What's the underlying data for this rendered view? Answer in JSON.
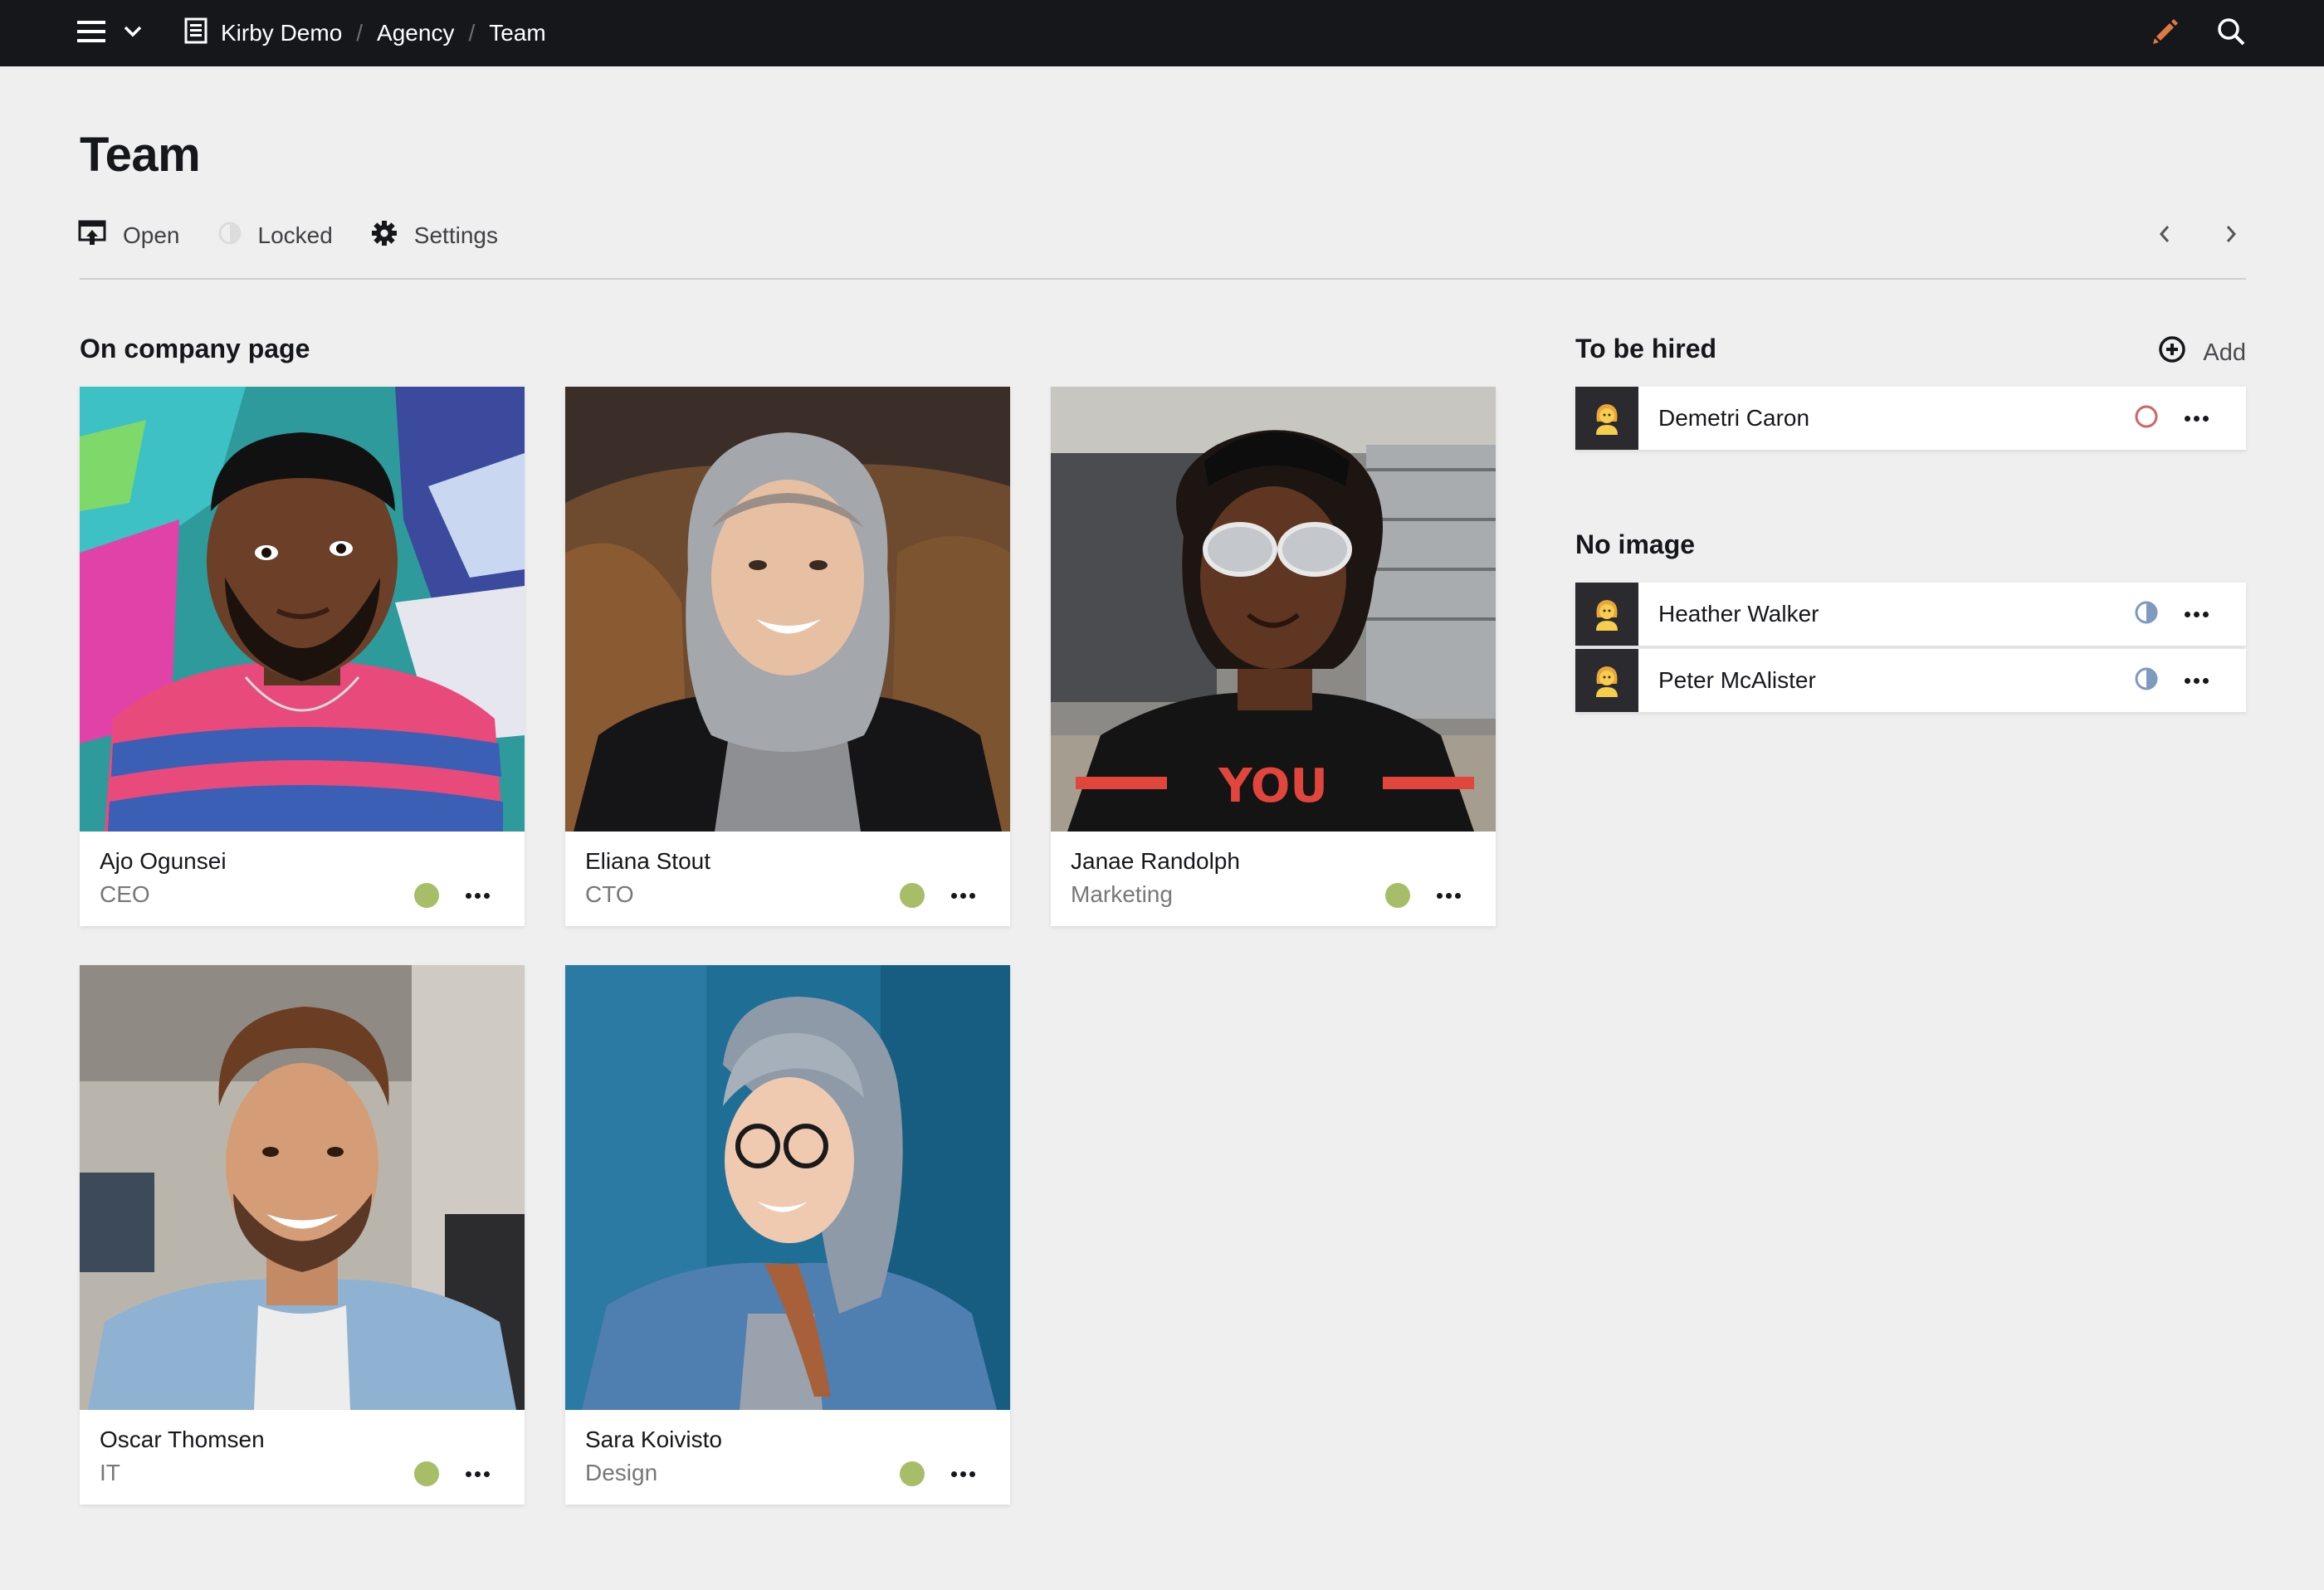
{
  "topbar": {
    "breadcrumbs": [
      {
        "label": "Kirby Demo",
        "icon": "page-icon"
      },
      {
        "label": "Agency"
      },
      {
        "label": "Team"
      }
    ],
    "separator": "/",
    "edit_icon_color": "#e07941"
  },
  "header": {
    "title": "Team",
    "actions": {
      "open": "Open",
      "locked": "Locked",
      "settings": "Settings"
    }
  },
  "sections": {
    "company": {
      "headline": "On company page",
      "cards": [
        {
          "name": "Ajo Ogunsei",
          "role": "CEO",
          "status": "listed",
          "photo": "portrait-graffiti-wall"
        },
        {
          "name": "Eliana Stout",
          "role": "CTO",
          "status": "listed",
          "photo": "portrait-grey-hoodie-leather-jacket"
        },
        {
          "name": "Janae Randolph",
          "role": "Marketing",
          "status": "listed",
          "photo": "portrait-sunglasses-cap"
        },
        {
          "name": "Oscar Thomsen",
          "role": "IT",
          "status": "listed",
          "photo": "portrait-office-denim-shirt"
        },
        {
          "name": "Sara Koivisto",
          "role": "Design",
          "status": "listed",
          "photo": "portrait-blue-wall-hoodie"
        }
      ]
    },
    "hire": {
      "headline": "To be hired",
      "add_label": "Add",
      "items": [
        {
          "name": "Demetri Caron",
          "status": "draft",
          "thumb": "person-emoji-icon"
        }
      ]
    },
    "noimage": {
      "headline": "No image",
      "items": [
        {
          "name": "Heather Walker",
          "status": "unlisted",
          "thumb": "person-emoji-icon"
        },
        {
          "name": "Peter McAlister",
          "status": "unlisted",
          "thumb": "person-emoji-icon"
        }
      ]
    }
  },
  "colors": {
    "listed": "#a7bd68",
    "draft": "#d16464",
    "unlisted": "#7e9abf"
  }
}
